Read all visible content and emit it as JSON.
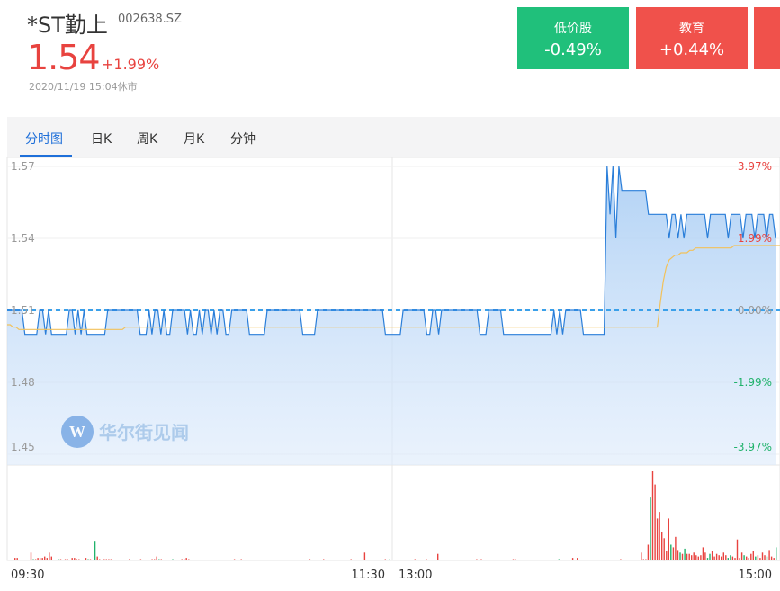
{
  "stock": {
    "name": "*ST勤上",
    "code": "002638.SZ",
    "price": "1.54",
    "change": "+1.99%",
    "time": "2020/11/19 15:04休市"
  },
  "tags": [
    {
      "name": "低价股",
      "value": "-0.49%",
      "color": "#20c07b"
    },
    {
      "name": "教育",
      "value": "+0.44%",
      "color": "#f0514b"
    },
    {
      "name": "",
      "value": "",
      "color": "#f0514b"
    }
  ],
  "tabs": [
    "分时图",
    "日K",
    "周K",
    "月K",
    "分钟"
  ],
  "watermark": "华尔街见闻",
  "chart_data": {
    "type": "line",
    "prev_close": 1.51,
    "ylim": [
      1.45,
      1.57
    ],
    "y_ticks": [
      "1.57",
      "1.54",
      "1.51",
      "1.48",
      "1.45"
    ],
    "pct_ticks": [
      {
        "label": "3.97%",
        "value": 1.57,
        "color": "#e8433f"
      },
      {
        "label": "1.99%",
        "value": 1.54,
        "color": "#e8433f"
      },
      {
        "label": "0.00%",
        "value": 1.51,
        "color": "#999999"
      },
      {
        "label": "-1.99%",
        "value": 1.48,
        "color": "#20b26b"
      },
      {
        "label": "-3.97%",
        "value": 1.45,
        "color": "#20b26b"
      }
    ],
    "x_ticks": [
      "09:30",
      "11:30",
      "13:00",
      "15:00"
    ],
    "series": [
      {
        "role": "price",
        "color": "#2a7ed9",
        "values": [
          1.51,
          1.51,
          1.51,
          1.51,
          1.51,
          1.51,
          1.5,
          1.5,
          1.5,
          1.5,
          1.5,
          1.51,
          1.51,
          1.5,
          1.51,
          1.5,
          1.5,
          1.5,
          1.5,
          1.5,
          1.5,
          1.51,
          1.51,
          1.5,
          1.51,
          1.5,
          1.51,
          1.5,
          1.5,
          1.5,
          1.5,
          1.5,
          1.5,
          1.5,
          1.51,
          1.51,
          1.51,
          1.51,
          1.51,
          1.51,
          1.51,
          1.51,
          1.51,
          1.51,
          1.51,
          1.5,
          1.5,
          1.5,
          1.51,
          1.5,
          1.51,
          1.51,
          1.5,
          1.51,
          1.5,
          1.5,
          1.51,
          1.51,
          1.51,
          1.51,
          1.51,
          1.5,
          1.51,
          1.5,
          1.5,
          1.51,
          1.5,
          1.51,
          1.51,
          1.5,
          1.51,
          1.5,
          1.51,
          1.51,
          1.5,
          1.5,
          1.51,
          1.51,
          1.51,
          1.51,
          1.51,
          1.51,
          1.5,
          1.5,
          1.5,
          1.5,
          1.5,
          1.5,
          1.51,
          1.51,
          1.51,
          1.51,
          1.51,
          1.51,
          1.51,
          1.51,
          1.51,
          1.51,
          1.51,
          1.51,
          1.5,
          1.5,
          1.5,
          1.5,
          1.5,
          1.51,
          1.51,
          1.51,
          1.51,
          1.51,
          1.51,
          1.51,
          1.51,
          1.51,
          1.51,
          1.51,
          1.51,
          1.51,
          1.51,
          1.51,
          1.51,
          1.51,
          1.51,
          1.51,
          1.51,
          1.51,
          1.51,
          1.51,
          1.5,
          1.5,
          1.5,
          1.5,
          1.5,
          1.5,
          1.51,
          1.51,
          1.51,
          1.51,
          1.51,
          1.51,
          1.51,
          1.51,
          1.5,
          1.5,
          1.51,
          1.51,
          1.5,
          1.51,
          1.51,
          1.51,
          1.51,
          1.51,
          1.51,
          1.51,
          1.51,
          1.51,
          1.51,
          1.51,
          1.51,
          1.51,
          1.5,
          1.5,
          1.5,
          1.51,
          1.51,
          1.51,
          1.51,
          1.51,
          1.5,
          1.5,
          1.5,
          1.5,
          1.5,
          1.5,
          1.5,
          1.5,
          1.5,
          1.5,
          1.5,
          1.5,
          1.5,
          1.5,
          1.5,
          1.5,
          1.5,
          1.51,
          1.5,
          1.51,
          1.5,
          1.51,
          1.51,
          1.51,
          1.51,
          1.51,
          1.51,
          1.5,
          1.5,
          1.5,
          1.5,
          1.5,
          1.5,
          1.5,
          1.5,
          1.57,
          1.55,
          1.57,
          1.54,
          1.57,
          1.56,
          1.56,
          1.56,
          1.56,
          1.56,
          1.56,
          1.56,
          1.56,
          1.56,
          1.55,
          1.55,
          1.55,
          1.55,
          1.55,
          1.55,
          1.55,
          1.54,
          1.55,
          1.55,
          1.54,
          1.55,
          1.54,
          1.55,
          1.55,
          1.55,
          1.55,
          1.55,
          1.55,
          1.55,
          1.54,
          1.55,
          1.55,
          1.55,
          1.55,
          1.55,
          1.55,
          1.54,
          1.55,
          1.55,
          1.55,
          1.55,
          1.54,
          1.55,
          1.55,
          1.55,
          1.54,
          1.55,
          1.55,
          1.55,
          1.54,
          1.55,
          1.55,
          1.54
        ]
      },
      {
        "role": "average",
        "color": "#f2c15a",
        "values": [
          1.504,
          1.504,
          1.503,
          1.503,
          1.502,
          1.502,
          1.502,
          1.502,
          1.502,
          1.502,
          1.502,
          1.502,
          1.502,
          1.502,
          1.502,
          1.502,
          1.502,
          1.502,
          1.502,
          1.502,
          1.502,
          1.502,
          1.502,
          1.502,
          1.502,
          1.502,
          1.502,
          1.502,
          1.502,
          1.502,
          1.502,
          1.502,
          1.502,
          1.502,
          1.502,
          1.502,
          1.502,
          1.502,
          1.502,
          1.502,
          1.503,
          1.503,
          1.503,
          1.503,
          1.503,
          1.503,
          1.503,
          1.503,
          1.503,
          1.503,
          1.503,
          1.503,
          1.503,
          1.503,
          1.503,
          1.503,
          1.503,
          1.503,
          1.503,
          1.503,
          1.503,
          1.503,
          1.503,
          1.503,
          1.503,
          1.503,
          1.503,
          1.503,
          1.503,
          1.503,
          1.503,
          1.503,
          1.503,
          1.503,
          1.503,
          1.503,
          1.503,
          1.503,
          1.503,
          1.503,
          1.503,
          1.503,
          1.503,
          1.503,
          1.503,
          1.503,
          1.503,
          1.503,
          1.503,
          1.503,
          1.503,
          1.503,
          1.503,
          1.503,
          1.503,
          1.503,
          1.503,
          1.503,
          1.503,
          1.503,
          1.503,
          1.503,
          1.503,
          1.503,
          1.503,
          1.503,
          1.503,
          1.503,
          1.503,
          1.503,
          1.503,
          1.503,
          1.503,
          1.503,
          1.503,
          1.503,
          1.503,
          1.503,
          1.503,
          1.503,
          1.503,
          1.503,
          1.503,
          1.503,
          1.503,
          1.503,
          1.503,
          1.503,
          1.503,
          1.503,
          1.503,
          1.503,
          1.503,
          1.503,
          1.503,
          1.503,
          1.503,
          1.503,
          1.503,
          1.503,
          1.503,
          1.503,
          1.503,
          1.503,
          1.503,
          1.503,
          1.503,
          1.503,
          1.503,
          1.503,
          1.503,
          1.503,
          1.503,
          1.503,
          1.503,
          1.503,
          1.503,
          1.503,
          1.503,
          1.503,
          1.503,
          1.503,
          1.503,
          1.503,
          1.503,
          1.503,
          1.503,
          1.503,
          1.503,
          1.503,
          1.503,
          1.503,
          1.503,
          1.503,
          1.503,
          1.503,
          1.503,
          1.503,
          1.503,
          1.503,
          1.503,
          1.503,
          1.503,
          1.503,
          1.503,
          1.503,
          1.503,
          1.503,
          1.503,
          1.503,
          1.503,
          1.503,
          1.503,
          1.503,
          1.503,
          1.503,
          1.503,
          1.503,
          1.503,
          1.503,
          1.503,
          1.503,
          1.503,
          1.503,
          1.503,
          1.503,
          1.503,
          1.503,
          1.503,
          1.503,
          1.503,
          1.503,
          1.503,
          1.503,
          1.503,
          1.503,
          1.503,
          1.503,
          1.503,
          1.503,
          1.503,
          1.513,
          1.522,
          1.528,
          1.531,
          1.532,
          1.533,
          1.533,
          1.534,
          1.534,
          1.534,
          1.535,
          1.535,
          1.536,
          1.536,
          1.536,
          1.536,
          1.536,
          1.536,
          1.536,
          1.536,
          1.536,
          1.536,
          1.536,
          1.536,
          1.536,
          1.537,
          1.537,
          1.537,
          1.537,
          1.537,
          1.537,
          1.537,
          1.537,
          1.537,
          1.537,
          1.537,
          1.537,
          1.537,
          1.537,
          1.537,
          1.537,
          1.537,
          1.537,
          1.537,
          1.537,
          1.537,
          1.537,
          1.537,
          1.537,
          1.537,
          1.537,
          1.537,
          1.537,
          1.537,
          1.537,
          1.537,
          1.537,
          1.535
        ]
      }
    ],
    "volume": {
      "values": [
        0.02,
        0.02,
        0,
        0,
        0,
        0,
        0,
        0.06,
        0.01,
        0.01,
        0.02,
        0.02,
        0.02,
        0.03,
        0.02,
        0.06,
        0.03,
        0,
        0,
        0.01,
        0.01,
        0,
        0.01,
        0.01,
        0,
        0.02,
        0.02,
        0.01,
        0.01,
        0,
        0,
        0.02,
        0.01,
        0.01,
        0,
        0.15,
        0.03,
        0.01,
        0,
        0.01,
        0.01,
        0.01,
        0.01,
        0,
        0,
        0,
        0,
        0,
        0,
        0,
        0.01,
        0,
        0,
        0,
        0,
        0.01,
        0,
        0,
        0,
        0,
        0.01,
        0.01,
        0.03,
        0.01,
        0.01,
        0,
        0,
        0,
        0,
        0.01,
        0,
        0,
        0,
        0.01,
        0.01,
        0.02,
        0.01,
        0,
        0,
        0,
        0,
        0,
        0,
        0,
        0,
        0,
        0,
        0,
        0,
        0,
        0,
        0,
        0,
        0,
        0,
        0,
        0.01,
        0,
        0,
        0.01,
        0,
        0,
        0,
        0,
        0,
        0,
        0,
        0,
        0,
        0,
        0,
        0,
        0,
        0,
        0,
        0,
        0,
        0,
        0,
        0,
        0,
        0,
        0,
        0,
        0,
        0,
        0,
        0,
        0,
        0.01,
        0,
        0,
        0,
        0,
        0,
        0.01,
        0,
        0,
        0,
        0,
        0,
        0,
        0,
        0,
        0,
        0,
        0,
        0.01,
        0,
        0,
        0,
        0,
        0,
        0.06,
        0,
        0,
        0,
        0,
        0,
        0,
        0,
        0,
        0.01,
        0,
        0.01,
        0,
        0,
        0,
        0,
        0,
        0,
        0,
        0,
        0,
        0,
        0.01,
        0,
        0,
        0,
        0,
        0.01,
        0,
        0,
        0,
        0,
        0.05,
        0,
        0,
        0,
        0,
        0,
        0,
        0,
        0,
        0,
        0,
        0,
        0,
        0,
        0,
        0,
        0,
        0.01,
        0,
        0.01,
        0,
        0,
        0,
        0,
        0,
        0,
        0,
        0,
        0,
        0,
        0,
        0,
        0,
        0.01,
        0.01,
        0,
        0,
        0,
        0,
        0,
        0,
        0,
        0,
        0,
        0,
        0,
        0,
        0,
        0,
        0,
        0,
        0,
        0,
        0.01,
        0,
        0,
        0,
        0,
        0,
        0.02,
        0,
        0.02,
        0,
        0,
        0,
        0,
        0,
        0,
        0,
        0,
        0,
        0,
        0,
        0,
        0,
        0,
        0,
        0,
        0,
        0,
        0.01,
        0,
        0,
        0,
        0,
        0,
        0,
        0,
        0,
        0.06,
        0.01,
        0.01,
        0.12,
        0.48,
        0.68,
        0.58,
        0.32,
        0.37,
        0.22,
        0.17,
        0.07,
        0.32,
        0.12,
        0.1,
        0.18,
        0.08,
        0.06,
        0.05,
        0.09,
        0.05,
        0.05,
        0.04,
        0.06,
        0.04,
        0.03,
        0.04,
        0.1,
        0.06,
        0.02,
        0.05,
        0.07,
        0.03,
        0.05,
        0.04,
        0.03,
        0.06,
        0.04,
        0.02,
        0.04,
        0.03,
        0.02,
        0.16,
        0.02,
        0.06,
        0.04,
        0.03,
        0.02,
        0.05,
        0.07,
        0.03,
        0.04,
        0.02,
        0.06,
        0.04,
        0.03,
        0.08,
        0.03,
        0.02,
        0.1
      ],
      "up_color": "#e8433f",
      "down_color": "#20b26b"
    }
  }
}
